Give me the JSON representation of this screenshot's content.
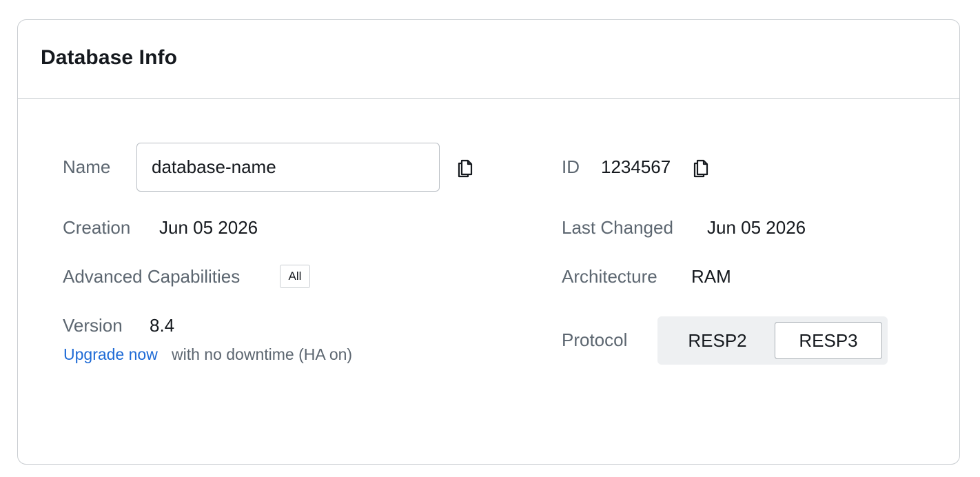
{
  "card": {
    "title": "Database Info"
  },
  "left": {
    "name_label": "Name",
    "name_value": "database-name",
    "creation_label": "Creation",
    "creation_value": "Jun 05 2026",
    "capabilities_label": "Advanced Capabilities",
    "capabilities_badge": "All",
    "version_label": "Version",
    "version_value": "8.4",
    "upgrade_link": "Upgrade now",
    "upgrade_note": "with no downtime (HA on)"
  },
  "right": {
    "id_label": "ID",
    "id_value": "1234567",
    "last_changed_label": "Last Changed",
    "last_changed_value": "Jun 05 2026",
    "architecture_label": "Architecture",
    "architecture_value": "RAM",
    "protocol_label": "Protocol",
    "protocol_options": [
      "RESP2",
      "RESP3"
    ],
    "protocol_selected": "RESP3"
  },
  "icons": {
    "copy": "copy-icon"
  },
  "colors": {
    "link": "#1f6bd6",
    "label": "#5c6670",
    "border": "#c9cdd1",
    "segment_bg": "#eef0f2"
  }
}
